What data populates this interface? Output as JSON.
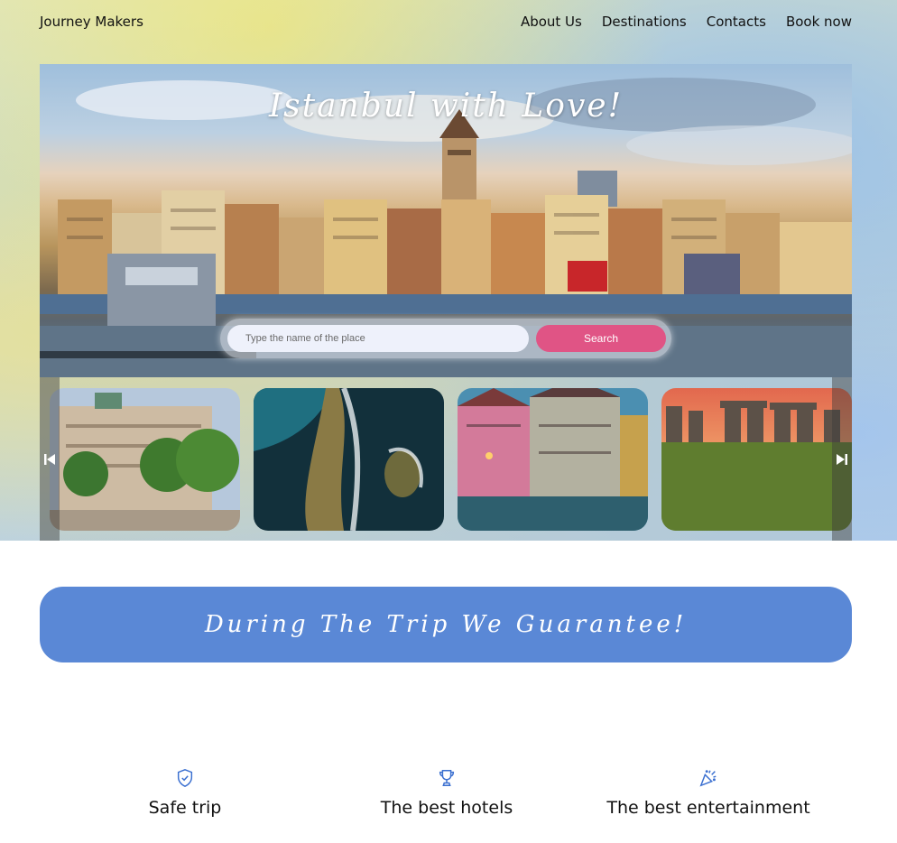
{
  "header": {
    "logo": "Journey Makers",
    "nav": [
      "About Us",
      "Destinations",
      "Contacts",
      "Book now"
    ]
  },
  "hero": {
    "title": "Istanbul with Love!",
    "image": "istanbul-galata-skyline",
    "search": {
      "placeholder": "Type the name of the place",
      "value": "",
      "button_label": "Search"
    }
  },
  "carousel": {
    "cards": [
      {
        "image": "palace-with-trees"
      },
      {
        "image": "aerial-coastline"
      },
      {
        "image": "colorful-half-timbered-houses"
      },
      {
        "image": "stonehenge-sunset"
      }
    ],
    "prev_icon": "skip-back-icon",
    "next_icon": "skip-forward-icon"
  },
  "banner": {
    "text": "During The Trip We Guarantee!"
  },
  "features": [
    {
      "icon": "shield-check-icon",
      "label": "Safe trip"
    },
    {
      "icon": "trophy-icon",
      "label": "The best hotels"
    },
    {
      "icon": "party-popper-icon",
      "label": "The best entertainment"
    }
  ],
  "colors": {
    "accent_pink": "#e05485",
    "banner_blue": "#5a88d6",
    "icon_blue": "#3a6fd0"
  }
}
